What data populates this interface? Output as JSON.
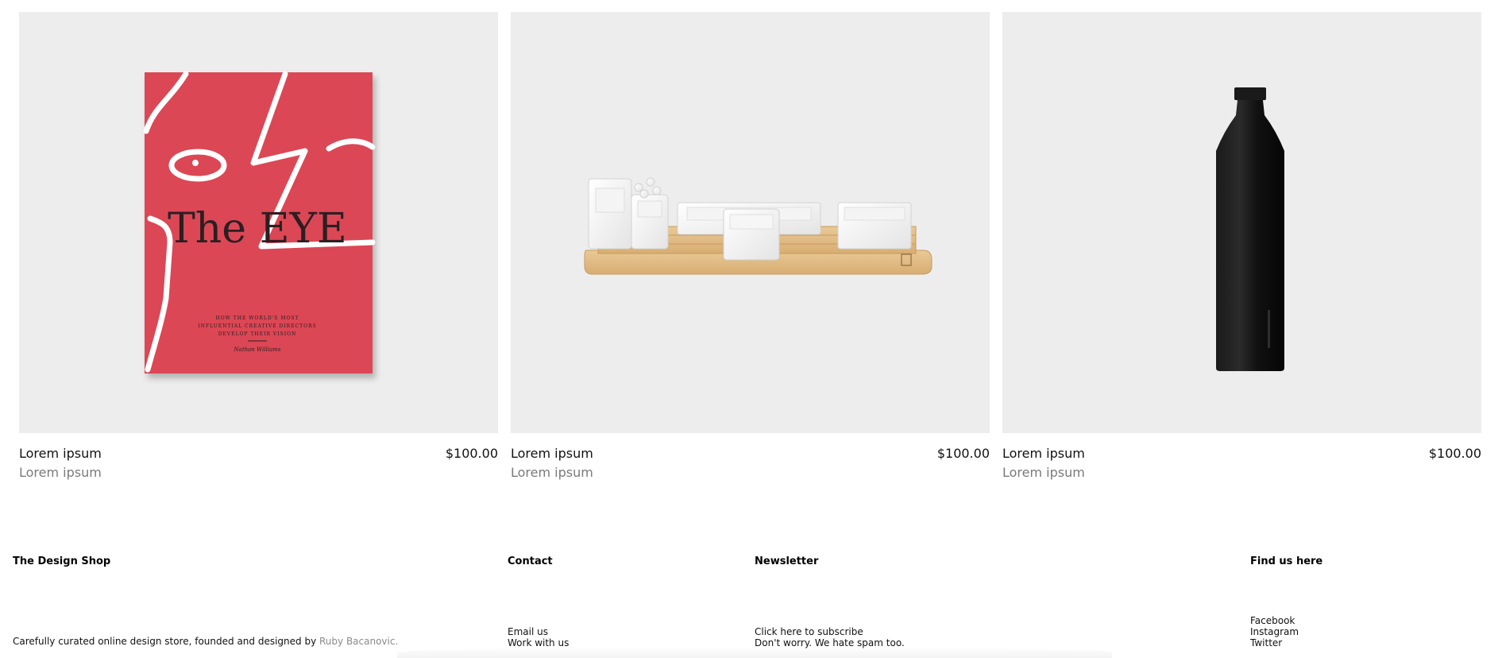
{
  "products": [
    {
      "name": "Lorem ipsum",
      "subtitle": "Lorem ipsum",
      "price": "$100.00",
      "image_icon": "book-cover-icon",
      "cover": {
        "title": "The EYE",
        "lines": [
          "HOW THE WORLD'S MOST",
          "INFLUENTIAL CREATIVE DIRECTORS",
          "DEVELOP THEIR VISION"
        ],
        "author": "Nathan Williams",
        "color": "#dc4654"
      }
    },
    {
      "name": "Lorem ipsum",
      "subtitle": "Lorem ipsum",
      "price": "$100.00",
      "image_icon": "desk-organizer-icon"
    },
    {
      "name": "Lorem ipsum",
      "subtitle": "Lorem ipsum",
      "price": "$100.00",
      "image_icon": "bottle-icon"
    }
  ],
  "footer": {
    "about": {
      "heading": "The Design Shop",
      "text": "Carefully curated online design store, founded and designed by",
      "link": "Ruby Bacanovic."
    },
    "contact": {
      "heading": "Contact",
      "links": [
        "Email us",
        "Work with us"
      ]
    },
    "newsletter": {
      "heading": "Newsletter",
      "subscribe": "Click here to subscribe",
      "note": "Don't worry. We hate spam too."
    },
    "social": {
      "heading": "Find us here",
      "links": [
        "Facebook",
        "Instagram",
        "Twitter"
      ]
    }
  },
  "colors": {
    "card_bg": "#ededed",
    "muted_text": "#7a7a7a",
    "link_gray": "#8a8a8a"
  }
}
